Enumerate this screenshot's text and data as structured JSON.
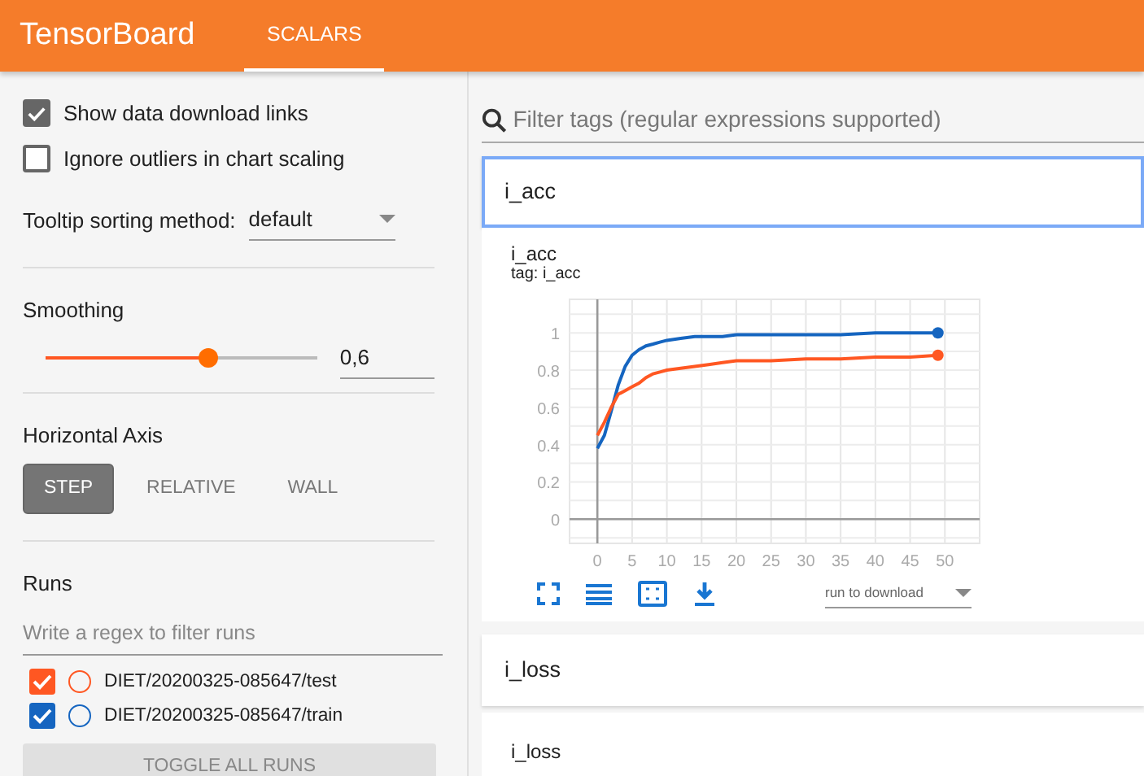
{
  "header": {
    "title": "TensorBoard",
    "tabs": [
      {
        "label": "SCALARS",
        "selected": true
      }
    ]
  },
  "sidebar": {
    "options": [
      {
        "label": "Show data download links",
        "checked": true
      },
      {
        "label": "Ignore outliers in chart scaling",
        "checked": false
      }
    ],
    "tooltip_sorting": {
      "label": "Tooltip sorting method:",
      "value": "default"
    },
    "smoothing": {
      "label": "Smoothing",
      "level": 0.6,
      "value": "0,6"
    },
    "horizontal_axis": {
      "label": "Horizontal Axis",
      "options": [
        {
          "label": "STEP",
          "selected": true
        },
        {
          "label": "RELATIVE",
          "selected": false
        },
        {
          "label": "WALL",
          "selected": false
        }
      ]
    },
    "runs": {
      "label": "Runs",
      "placeholder": "Write a regex to filter runs",
      "items": [
        {
          "name": "DIET/20200325-085647/test",
          "checked": true,
          "color": "#ff5722"
        },
        {
          "name": "DIET/20200325-085647/train",
          "checked": true,
          "color": "#1565c0"
        }
      ],
      "toggle_button": "TOGGLE ALL RUNS"
    }
  },
  "main": {
    "search": {
      "placeholder": "Filter tags (regular expressions supported)"
    },
    "sections": [
      {
        "kind": "group",
        "title": "i_acc",
        "selected": true
      },
      {
        "kind": "chart",
        "title": "i_acc",
        "tag": "tag: i_acc",
        "download_placeholder": "run to download",
        "chart_data": {
          "type": "line",
          "x": [
            0,
            1,
            2,
            3,
            4,
            5,
            6,
            7,
            8,
            9,
            10,
            12,
            14,
            16,
            18,
            20,
            25,
            30,
            35,
            40,
            45,
            49
          ],
          "series": [
            {
              "color": "#1565c0",
              "values": [
                0.38,
                0.45,
                0.58,
                0.72,
                0.82,
                0.88,
                0.91,
                0.93,
                0.94,
                0.95,
                0.96,
                0.97,
                0.98,
                0.98,
                0.98,
                0.99,
                0.99,
                0.99,
                0.99,
                1.0,
                1.0,
                1.0
              ]
            },
            {
              "color": "#ff5722",
              "values": [
                0.45,
                0.52,
                0.6,
                0.67,
                0.69,
                0.71,
                0.73,
                0.76,
                0.78,
                0.79,
                0.8,
                0.81,
                0.82,
                0.83,
                0.84,
                0.85,
                0.85,
                0.86,
                0.86,
                0.87,
                0.87,
                0.88
              ]
            }
          ],
          "grid": true,
          "xlim": [
            -4,
            55
          ],
          "ylim": [
            -0.13,
            1.18
          ],
          "xticks": [
            0,
            5,
            10,
            15,
            20,
            25,
            30,
            35,
            40,
            45,
            50
          ],
          "yticks": [
            0,
            0.2,
            0.4,
            0.6,
            0.8,
            1
          ]
        }
      },
      {
        "kind": "group",
        "title": "i_loss",
        "selected": false
      },
      {
        "kind": "chart_stub",
        "title": "i_loss"
      }
    ]
  }
}
